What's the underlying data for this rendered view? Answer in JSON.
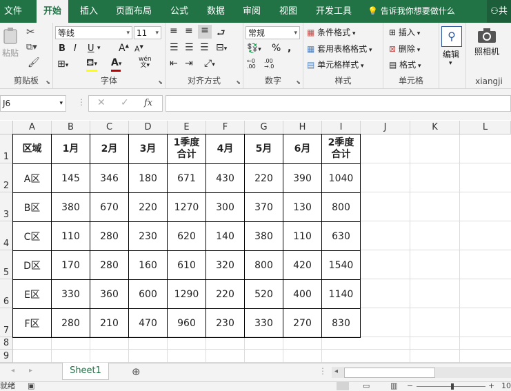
{
  "menu": {
    "items": [
      "文件",
      "开始",
      "插入",
      "页面布局",
      "公式",
      "数据",
      "审阅",
      "视图",
      "开发工具"
    ],
    "active_index": 1,
    "tell_me": "告诉我你想要做什么",
    "share": "共"
  },
  "ribbon": {
    "clipboard": {
      "paste": "粘贴",
      "label": "剪贴板"
    },
    "font": {
      "name": "等线",
      "size": "11",
      "bold": "B",
      "italic": "I",
      "underline": "U",
      "grow": "A",
      "shrink": "A",
      "phonetic": "wén",
      "label": "字体"
    },
    "alignment": {
      "label": "对齐方式"
    },
    "number": {
      "format": "常规",
      "percent": "%",
      "label": "数字"
    },
    "styles": {
      "conditional": "条件格式",
      "table": "套用表格格式",
      "cell": "单元格样式",
      "label": "样式"
    },
    "cells": {
      "insert": "插入",
      "delete": "删除",
      "format": "格式",
      "label": "单元格"
    },
    "editing": {
      "label": "编辑"
    },
    "camera": {
      "label": "照相机",
      "group": "xiangji"
    }
  },
  "formula_bar": {
    "name_box": "J6",
    "fx": "fx",
    "value": ""
  },
  "sheet": {
    "columns": [
      "A",
      "B",
      "C",
      "D",
      "E",
      "F",
      "G",
      "H",
      "I",
      "J",
      "K",
      "L"
    ],
    "rows": [
      "1",
      "2",
      "3",
      "4",
      "5",
      "6",
      "7",
      "8",
      "9"
    ],
    "header": [
      "区域",
      "1月",
      "2月",
      "3月",
      "1季度\n合计",
      "4月",
      "5月",
      "6月",
      "2季度\n合计"
    ],
    "data": [
      [
        "A区",
        "145",
        "346",
        "180",
        "671",
        "430",
        "220",
        "390",
        "1040"
      ],
      [
        "B区",
        "380",
        "670",
        "220",
        "1270",
        "300",
        "370",
        "130",
        "800"
      ],
      [
        "C区",
        "110",
        "280",
        "230",
        "620",
        "140",
        "380",
        "110",
        "630"
      ],
      [
        "D区",
        "170",
        "280",
        "160",
        "610",
        "320",
        "800",
        "420",
        "1540"
      ],
      [
        "E区",
        "330",
        "360",
        "600",
        "1290",
        "220",
        "520",
        "400",
        "1140"
      ],
      [
        "F区",
        "280",
        "210",
        "470",
        "960",
        "230",
        "330",
        "270",
        "830"
      ]
    ]
  },
  "sheet_tabs": {
    "active": "Sheet1",
    "add": "⊕"
  },
  "status": {
    "ready": "就绪",
    "zoom": "10"
  },
  "colors": {
    "brand": "#217346"
  }
}
